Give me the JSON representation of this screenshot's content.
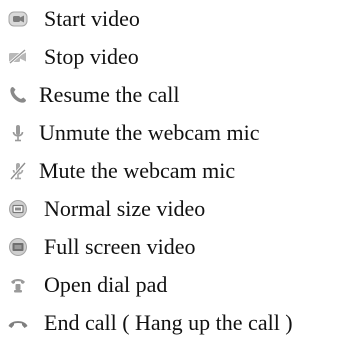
{
  "legend": {
    "items": [
      {
        "icon": "camera-icon",
        "label": "Start video"
      },
      {
        "icon": "camera-off-icon",
        "label": "Stop video"
      },
      {
        "icon": "phone-icon",
        "label": "Resume the call"
      },
      {
        "icon": "microphone-icon",
        "label": "Unmute the webcam mic"
      },
      {
        "icon": "microphone-muted-icon",
        "label": "Mute the webcam mic"
      },
      {
        "icon": "normal-size-video-icon",
        "label": "Normal size video"
      },
      {
        "icon": "full-screen-video-icon",
        "label": "Full screen video"
      },
      {
        "icon": "dial-pad-icon",
        "label": "Open dial pad"
      },
      {
        "icon": "hang-up-icon",
        "label": "End call ( Hang up the call )"
      }
    ]
  },
  "colors": {
    "icon_gray": "#9a9a9a",
    "icon_dark": "#6f6f6f",
    "text": "#111111"
  }
}
